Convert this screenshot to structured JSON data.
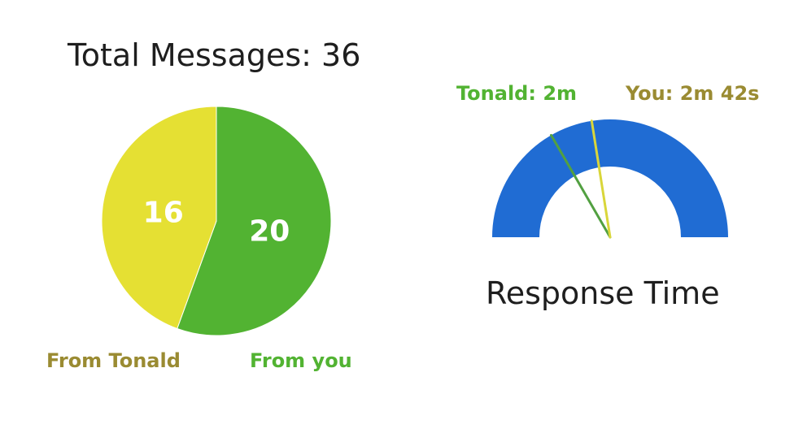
{
  "colors": {
    "tonald_slice": "#e5e033",
    "you_slice": "#52b332",
    "gauge_arc": "#206cd3",
    "tonald_label": "#9a8b32",
    "you_label": "#52b332",
    "tonald_needle": "#52a041",
    "you_needle": "#d9d63a",
    "title_text": "#1e1e1e"
  },
  "chart_data": [
    {
      "type": "pie",
      "title": "Total Messages: 36",
      "slices": [
        {
          "label": "From you",
          "value": 20
        },
        {
          "label": "From Tonald",
          "value": 16
        }
      ]
    },
    {
      "type": "gauge",
      "title": "Response Time",
      "range_seconds": [
        0,
        360
      ],
      "needles": [
        {
          "label": "Tonald: 2m",
          "value_seconds": 120
        },
        {
          "label": "You: 2m 42s",
          "value_seconds": 162
        }
      ]
    }
  ]
}
